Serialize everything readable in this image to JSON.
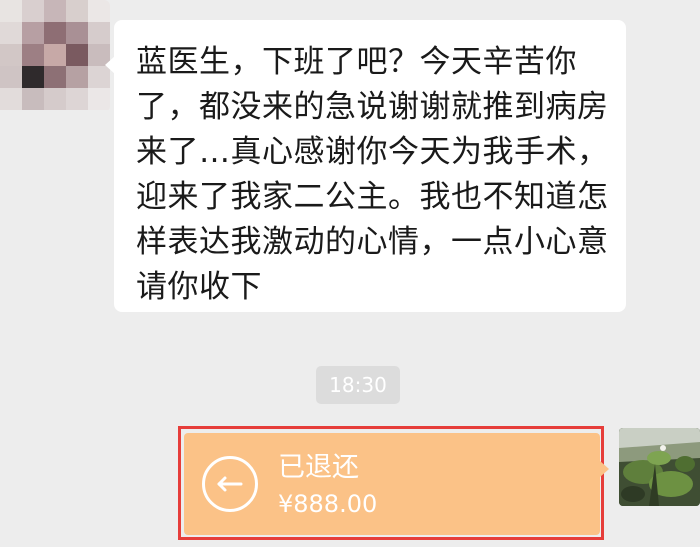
{
  "chat": {
    "incoming_message": {
      "lines": [
        "蓝医生，下班了吧？今天辛苦你",
        "了，都没来的急说谢谢就推到病房",
        "来了…真心感谢你今天为我手术，",
        "迎来了我家二公主。我也不知道怎",
        "样表达我激动的心情，一点小心意",
        "请你收下"
      ]
    },
    "timestamp": "18:30",
    "transfer": {
      "status": "已退还",
      "amount": "¥888.00"
    }
  },
  "colors": {
    "background": "#ededed",
    "bubble": "#ffffff",
    "transfer_card": "#fbc287",
    "highlight_border": "#e63d3a"
  }
}
